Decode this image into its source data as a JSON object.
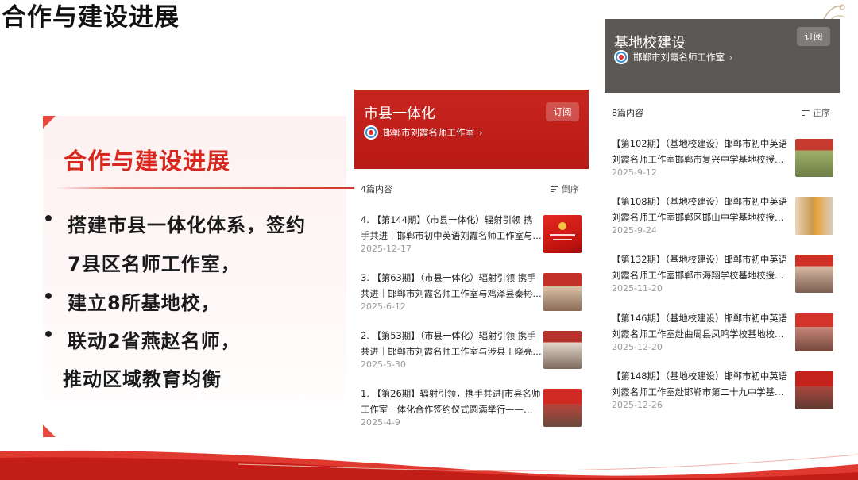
{
  "page": {
    "title": "合作与建设进展"
  },
  "left_card": {
    "heading": "合作与建设进展",
    "lines": [
      "搭建市县一体化体系，签约",
      "7县区名师工作室，",
      "建立8所基地校，",
      "联动2省燕赵名师，",
      "推动区域教育均衡"
    ],
    "bullet": "•"
  },
  "middle_panel": {
    "title": "市县一体化",
    "subtitle": "邯郸市刘霞名师工作室",
    "subscribe_label": "订阅",
    "count_label": "4篇内容",
    "sort_label": "倒序",
    "articles": [
      {
        "title_line1": "4. 【第144期】（市县一体化）辐射引领 携",
        "title_line2": "手共进｜邯郸市初中英语刘霞名师工作室与…",
        "date": "2025-12-17"
      },
      {
        "title_line1": "3. 【第63期】（市县一体化）辐射引领 携手",
        "title_line2": "共进｜邯郸市刘霞名师工作室与鸡泽县秦彬…",
        "date": "2025-6-12"
      },
      {
        "title_line1": "2. 【第53期】（市县一体化）辐射引领 携手",
        "title_line2": "共进｜邯郸市刘霞名师工作室与涉县王晓亮…",
        "date": "2025-5-30"
      },
      {
        "title_line1": "1. 【第26期】辐射引领，携手共进|市县名师",
        "title_line2": "工作室一体化合作签约仪式圆满举行——…",
        "date": "2025-4-9"
      }
    ]
  },
  "right_panel": {
    "title": "基地校建设",
    "subtitle": "邯郸市刘霞名师工作室",
    "subscribe_label": "订阅",
    "count_label": "8篇内容",
    "sort_label": "正序",
    "articles": [
      {
        "title_line1": "【第102期】（基地校建设）邯郸市初中英语",
        "title_line2": "刘霞名师工作室邯郸市复兴中学基地校授…",
        "date": "2025-9-12"
      },
      {
        "title_line1": "【第108期】（基地校建设）邯郸市初中英语",
        "title_line2": "刘霞名师工作室邯郸区邯山中学基地校授…",
        "date": "2025-9-24"
      },
      {
        "title_line1": "【第132期】（基地校建设）邯郸市初中英语",
        "title_line2": "刘霞名师工作室邯郸市海翔学校基地校授…",
        "date": "2025-11-20"
      },
      {
        "title_line1": "【第146期】（基地校建设）邯郸市初中英语",
        "title_line2": "刘霞名师工作室赴曲周县凤鸣学校基地校…",
        "date": "2025-12-20"
      },
      {
        "title_line1": "【第148期】（基地校建设）邯郸市初中英语",
        "title_line2": "刘霞名师工作室赴邯郸市第二十九中学基…",
        "date": "2025-12-26"
      }
    ]
  },
  "colors": {
    "accent_red": "#d8271d",
    "middle_header": "#c8251f",
    "right_header": "#5b5855",
    "date_gray": "#9a9a9a"
  },
  "icons": [
    "avatar-logo-icon",
    "chevron-right-icon",
    "sort-icon",
    "rope-decoration-icon"
  ]
}
